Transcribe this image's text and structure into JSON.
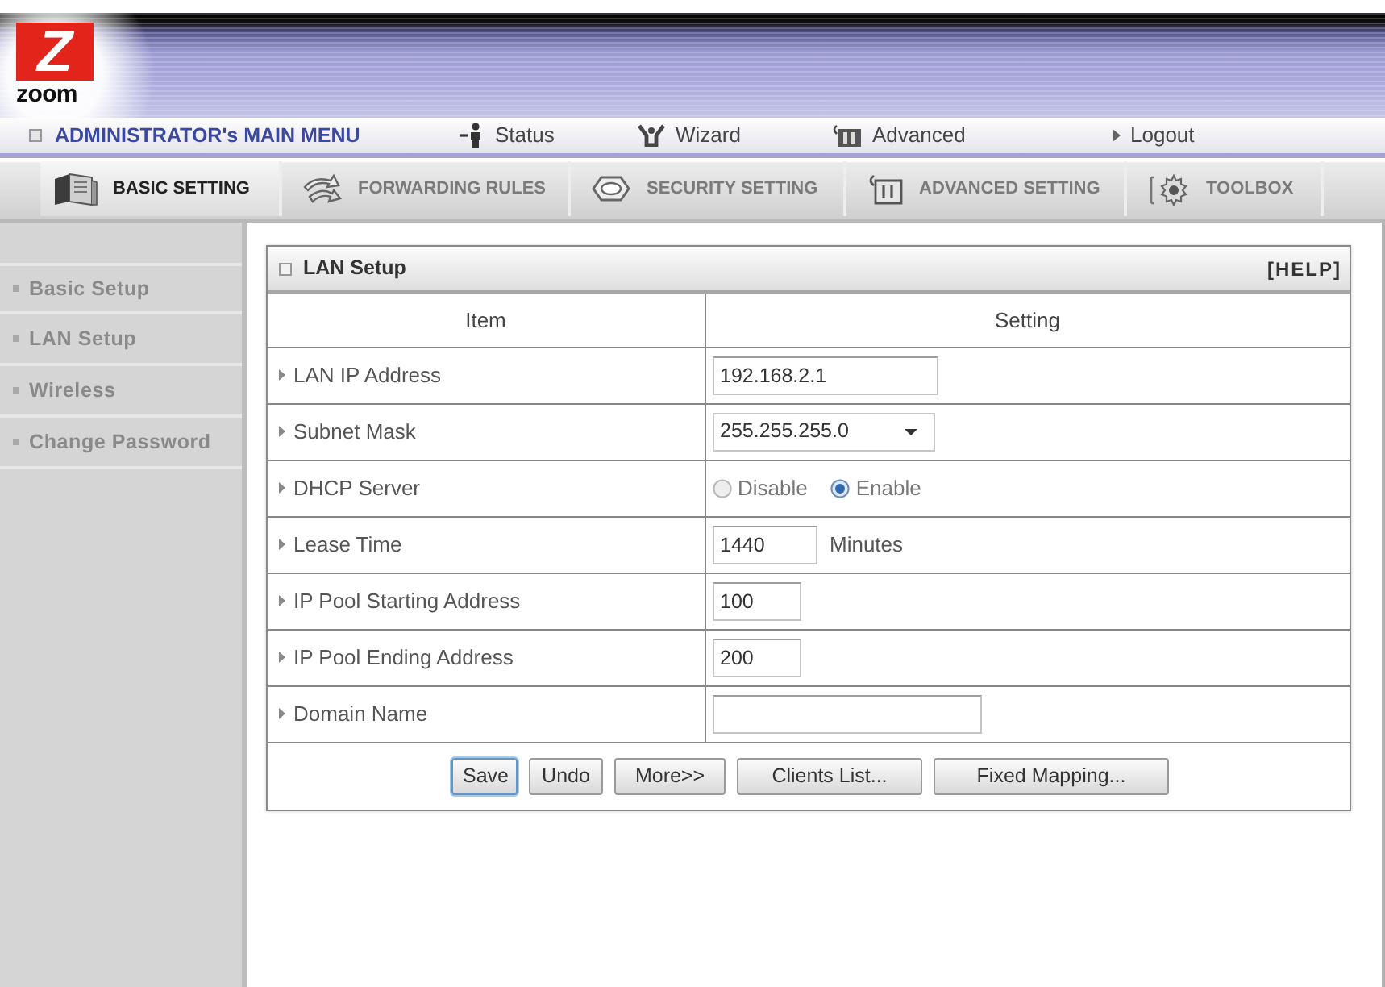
{
  "logo": {
    "mark": "Z",
    "text": "zoom"
  },
  "main_menu": {
    "title": "ADMINISTRATOR's MAIN MENU",
    "items": [
      {
        "label": "Status"
      },
      {
        "label": "Wizard"
      },
      {
        "label": "Advanced"
      },
      {
        "label": "Logout"
      }
    ]
  },
  "tabs": [
    {
      "label": "BASIC SETTING",
      "selected": true
    },
    {
      "label": "FORWARDING RULES",
      "selected": false
    },
    {
      "label": "SECURITY SETTING",
      "selected": false
    },
    {
      "label": "ADVANCED SETTING",
      "selected": false
    },
    {
      "label": "TOOLBOX",
      "selected": false
    }
  ],
  "sidebar": {
    "items": [
      {
        "label": "Basic Setup"
      },
      {
        "label": "LAN Setup"
      },
      {
        "label": "Wireless"
      },
      {
        "label": "Change Password"
      }
    ]
  },
  "panel": {
    "title": "LAN Setup",
    "help": "[HELP]",
    "columns": [
      "Item",
      "Setting"
    ],
    "rows": [
      {
        "label": "LAN IP Address",
        "kind": "text",
        "value": "192.168.2.1"
      },
      {
        "label": "Subnet Mask",
        "kind": "select",
        "value": "255.255.255.0"
      },
      {
        "label": "DHCP Server",
        "kind": "radio",
        "options": [
          {
            "label": "Disable",
            "selected": false
          },
          {
            "label": "Enable",
            "selected": true
          }
        ]
      },
      {
        "label": "Lease Time",
        "kind": "text",
        "value": "1440",
        "unit": "Minutes"
      },
      {
        "label": "IP Pool Starting Address",
        "kind": "text",
        "value": "100"
      },
      {
        "label": "IP Pool Ending Address",
        "kind": "text",
        "value": "200"
      },
      {
        "label": "Domain Name",
        "kind": "text"
      }
    ],
    "buttons": [
      {
        "label": "Save",
        "focused": true
      },
      {
        "label": "Undo",
        "focused": false
      },
      {
        "label": "More>>",
        "focused": false
      },
      {
        "label": "Clients List...",
        "focused": false
      },
      {
        "label": "Fixed Mapping...",
        "focused": false
      }
    ]
  }
}
